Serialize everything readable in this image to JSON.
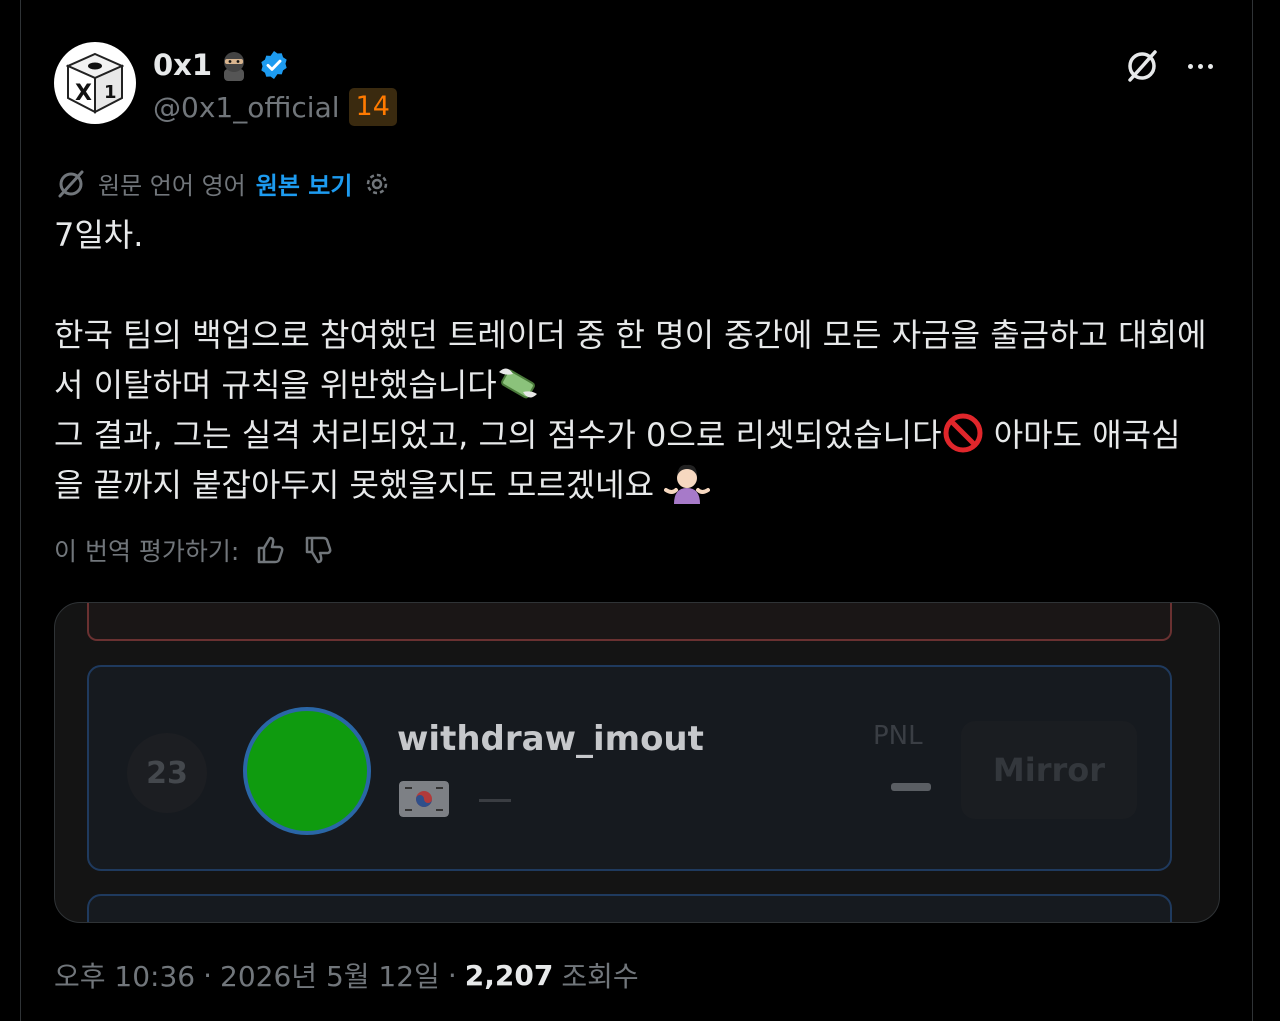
{
  "author": {
    "display_name": "0x1",
    "handle": "@0x1_official",
    "badge": "14",
    "verified": true,
    "avatar_icon": "dice-icon",
    "emoji_icon": "ninja-icon"
  },
  "translation": {
    "label": "원문 언어 영어",
    "view_original": "원본 보기"
  },
  "post": {
    "line1": "7일차.",
    "line2": "한국 팀의 백업으로 참여했던 트레이더 중 한 명이 중간에 모든 자금을 출금하고 대회에",
    "line3": "서 이탈하며 규칙을 위반했습니다",
    "line4": "그 결과, 그는 실격 처리되었고, 그의 점수가 0으로 리셋되었습니다",
    "line4b": " 아마도 애국심",
    "line5": "을 끝까지 붙잡아두지 못했을지도 모르겠네요 "
  },
  "rating": {
    "label": "이 번역 평가하기:"
  },
  "media_card": {
    "rank": "23",
    "trader_name": "withdraw_imout",
    "pnl_label": "PNL",
    "mirror_label": "Mirror",
    "avatar_color": "#0f9b0f"
  },
  "meta": {
    "time": "오후 10:36",
    "date": "2026년 5월 12일",
    "views": "2,207",
    "views_label": "조회수"
  },
  "colors": {
    "accent": "#1d9bf0",
    "badge_text": "#ff7a00",
    "muted": "#71767b"
  }
}
